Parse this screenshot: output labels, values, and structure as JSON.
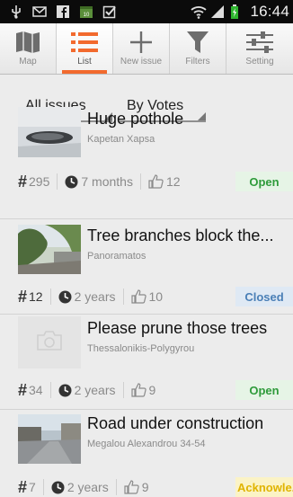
{
  "statusbar": {
    "time": "16:44"
  },
  "toolbar": {
    "buttons": [
      {
        "label": "Map",
        "icon": "map-icon"
      },
      {
        "label": "List",
        "icon": "list-icon"
      },
      {
        "label": "New issue",
        "icon": "plus-icon"
      },
      {
        "label": "Filters",
        "icon": "filter-icon"
      },
      {
        "label": "Setting",
        "icon": "settings-sliders-icon"
      }
    ],
    "active": "List",
    "accent": "#f26a2e"
  },
  "filters": {
    "scope": "All issues",
    "sort": "By Votes"
  },
  "issues": [
    {
      "title": "Huge pothole",
      "location": "Kapetan Xapsa",
      "id": "295",
      "age": "7 months",
      "votes": "12",
      "status": "Open"
    },
    {
      "title": "Tree branches block the...",
      "location": "Panoramatos",
      "id": "12",
      "age": "2 years",
      "votes": "10",
      "status": "Closed"
    },
    {
      "title": "Please prune those trees",
      "location": "Thessalonikis-Polygyrou",
      "id": "34",
      "age": "2 years",
      "votes": "9",
      "status": "Open"
    },
    {
      "title": "Road under construction",
      "location": "Megalou Alexandrou 34-54",
      "id": "7",
      "age": "2 years",
      "votes": "9",
      "status": "Acknowle..."
    }
  ],
  "status_colors": {
    "open": "#2e9b3a",
    "closed": "#4a7fb6",
    "acknowledged": "#e0b400"
  }
}
